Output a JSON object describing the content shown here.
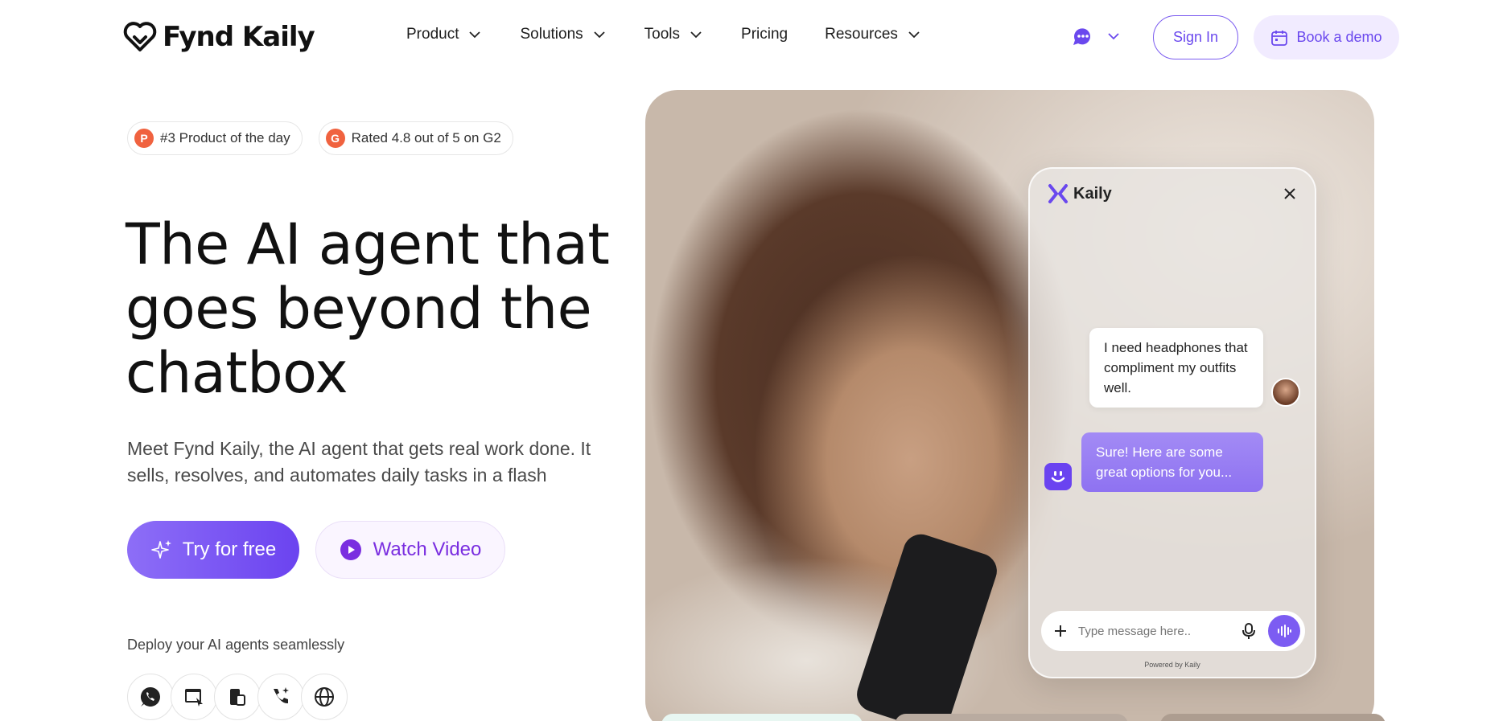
{
  "brand": {
    "name": "Fynd Kaily"
  },
  "nav": {
    "items": [
      {
        "label": "Product",
        "dropdown": true
      },
      {
        "label": "Solutions",
        "dropdown": true
      },
      {
        "label": "Tools",
        "dropdown": true
      },
      {
        "label": "Pricing",
        "dropdown": false
      },
      {
        "label": "Resources",
        "dropdown": true
      }
    ],
    "signin_label": "Sign In",
    "book_label": "Book a demo"
  },
  "badges": [
    {
      "text": "#3 Product of the day",
      "icon": "producthunt-icon",
      "letter": "P"
    },
    {
      "text": "Rated 4.8 out of 5 on G2",
      "icon": "g2-icon",
      "letter": "G"
    }
  ],
  "hero": {
    "headline_1": "The AI agent that",
    "headline_2": "goes beyond the",
    "headline_3": "chatbox",
    "subtitle": "Meet Fynd Kaily, the AI agent that gets real work done. It sells, resolves, and automates daily tasks in a flash",
    "try_label": "Try for free",
    "watch_label": "Watch Video"
  },
  "deploy": {
    "label": "Deploy your AI agents seamlessly",
    "channels": [
      "whatsapp-icon",
      "web-widget-icon",
      "app-icon",
      "voice-call-icon",
      "globe-icon"
    ]
  },
  "chat_widget": {
    "title": "Kaily",
    "user_message": "I need headphones that compliment my outfits well.",
    "bot_message": "Sure! Here are some great options for you...",
    "input_placeholder": "Type message here..",
    "powered_by": "Powered by Kaily"
  },
  "colors": {
    "accent": "#6a48ee",
    "accent_light": "#f1ebff",
    "badge_orange": "#f0623f",
    "watch_purple": "#7a2ee0"
  }
}
